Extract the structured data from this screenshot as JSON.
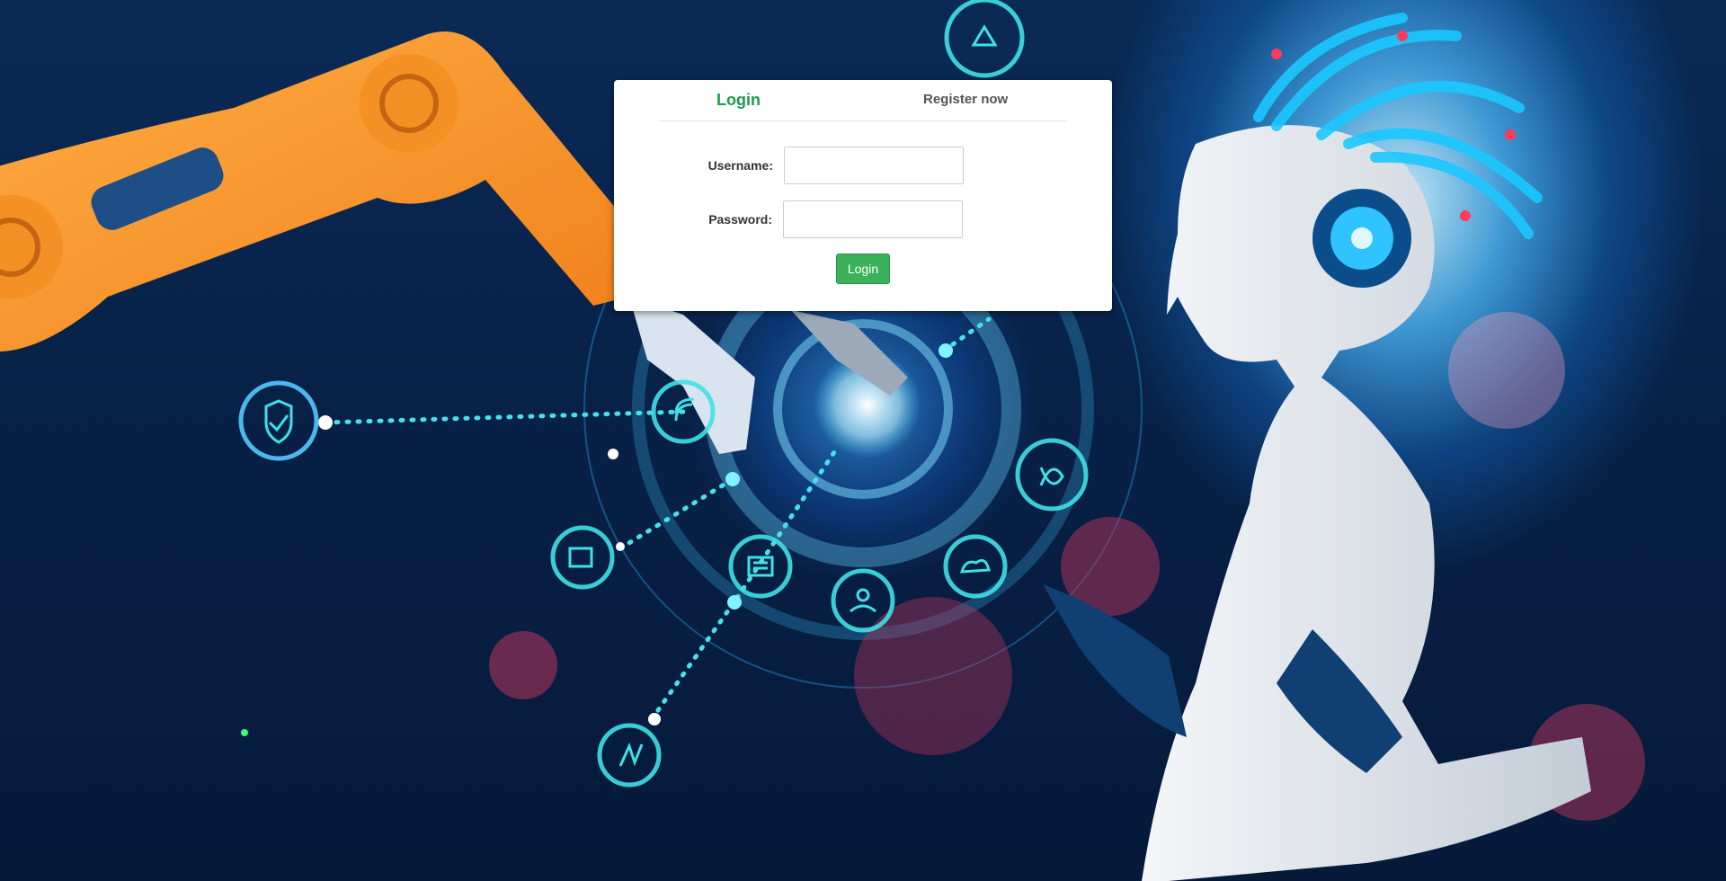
{
  "tabs": {
    "login_label": "Login",
    "register_label": "Register now"
  },
  "form": {
    "username_label": "Username:",
    "username_value": "",
    "password_label": "Password:",
    "password_value": "",
    "submit_label": "Login"
  },
  "colors": {
    "accent": "#1c9a4a",
    "button": "#3cb15c",
    "background": "#082147"
  },
  "background_icons": [
    "recycle-icon",
    "shield-check-icon",
    "wifi-icon",
    "camera-icon",
    "document-icon",
    "group-icon",
    "route-icon",
    "cloud-icon",
    "lightning-icon"
  ]
}
